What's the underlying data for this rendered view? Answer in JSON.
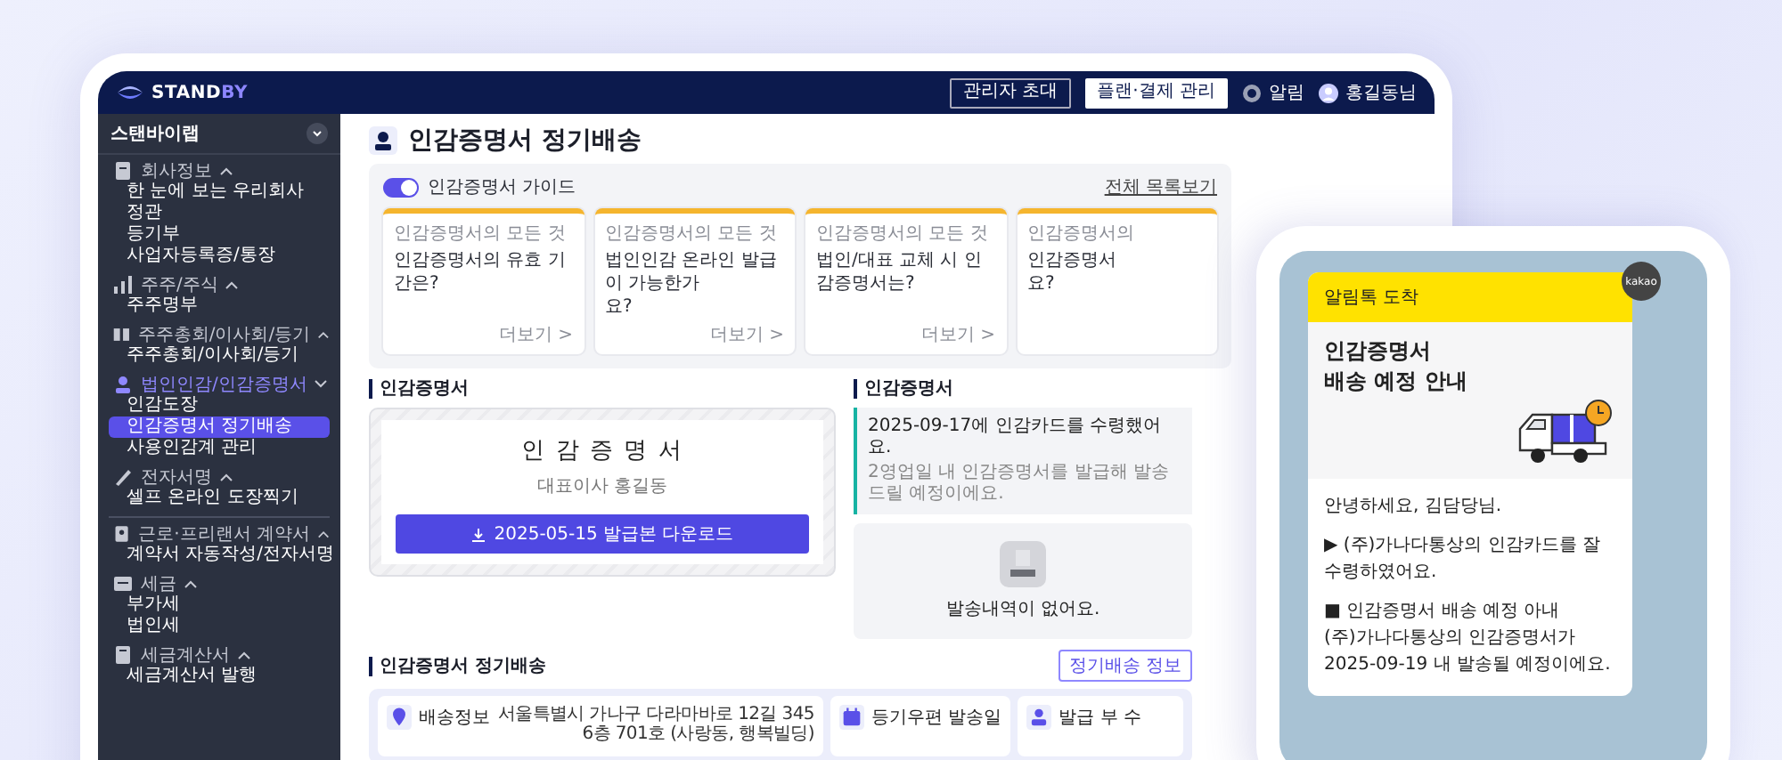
{
  "topbar": {
    "logo_parts": [
      "STAND",
      "BY"
    ],
    "buttons": [
      {
        "label": "관리자 초대",
        "kind": "outline"
      },
      {
        "label": "플랜·결제 관리",
        "kind": "filled"
      }
    ],
    "notifications": "알림",
    "user": "홍길동님"
  },
  "sidebar": {
    "company": "스탠바이랩",
    "groups": [
      {
        "title": "회사정보",
        "active": false,
        "divider_before": false,
        "items": [
          {
            "label": "한 눈에 보는 우리회사",
            "selected": false
          },
          {
            "label": "정관",
            "selected": false
          },
          {
            "label": "등기부",
            "selected": false
          },
          {
            "label": "사업자등록증/통장",
            "selected": false
          }
        ]
      },
      {
        "title": "주주/주식",
        "active": false,
        "divider_before": false,
        "items": [
          {
            "label": "주주명부",
            "selected": false
          }
        ]
      },
      {
        "title": "주주총회/이사회/등기",
        "active": false,
        "divider_before": false,
        "items": [
          {
            "label": "주주총회/이사회/등기",
            "selected": false
          }
        ]
      },
      {
        "title": "법인인감/인감증명서",
        "active": true,
        "divider_before": false,
        "items": [
          {
            "label": "인감도장",
            "selected": false
          },
          {
            "label": "인감증명서 정기배송",
            "selected": true
          },
          {
            "label": "사용인감계 관리",
            "selected": false
          }
        ]
      },
      {
        "title": "전자서명",
        "active": false,
        "divider_before": false,
        "items": [
          {
            "label": "셀프 온라인 도장찍기",
            "selected": false
          }
        ]
      },
      {
        "title": "근로·프리랜서 계약서",
        "active": false,
        "divider_before": true,
        "items": [
          {
            "label": "계약서 자동작성/전자서명",
            "selected": false
          }
        ]
      },
      {
        "title": "세금",
        "active": false,
        "divider_before": false,
        "items": [
          {
            "label": "부가세",
            "selected": false
          },
          {
            "label": "법인세",
            "selected": false
          }
        ]
      },
      {
        "title": "세금계산서",
        "active": false,
        "divider_before": false,
        "items": [
          {
            "label": "세금계산서 발행",
            "selected": false
          }
        ]
      }
    ]
  },
  "page_title": "인감증명서 정기배송",
  "guide": {
    "toggle_on": true,
    "title": "인감증명서 가이드",
    "all_link": "전체 목록보기",
    "cards": [
      {
        "label": "인감증명서의 모든 것",
        "question_lines": [
          "인감증명서의 유효 기간은?"
        ],
        "more": "더보기 >"
      },
      {
        "label": "인감증명서의 모든 것",
        "question_lines": [
          "법인인감 온라인 발급이 가능한가",
          "요?"
        ],
        "more": "더보기 >"
      },
      {
        "label": "인감증명서의 모든 것",
        "question_lines": [
          "법인/대표 교체 시 인감증명서는?"
        ],
        "more": "더보기 >"
      },
      {
        "label": "인감증명서의",
        "question_lines": [
          "인감증명서",
          "요?"
        ]
      }
    ]
  },
  "certificate": {
    "heading": "인감증명서",
    "doc_title": "인 감 증 명 서",
    "holder": "대표이사 홍길동",
    "download": "2025-05-15 발급본 다운로드"
  },
  "status": {
    "heading": "인감증명서",
    "notice_title": "2025-09-17에 인감카드를 수령했어요.",
    "notice_detail": "2영업일 내 인감증명서를 발급해 발송드릴 예정이에요.",
    "empty": "발송내역이 없어요."
  },
  "delivery": {
    "heading": "인감증명서 정기배송",
    "edit_button": "정기배송 정보",
    "cards": [
      {
        "kind": "address",
        "title": "배송정보",
        "value_lines": [
          "서울특별시 가나구 다라마바로 12길 345",
          "6층 701호 (사랑동, 행복빌딩)"
        ]
      },
      {
        "kind": "plain",
        "title": "등기우편 발송일"
      },
      {
        "kind": "plain",
        "title": "발급 부 수"
      }
    ]
  },
  "message": {
    "header": "알림톡 도착",
    "badge": "kakao",
    "title_lines": [
      "인감증명서",
      "배송 예정 안내"
    ],
    "paragraphs": [
      "안녕하세요, 김담당님.",
      "▶ (주)가나다통상의 인감카드를 잘 수령하였어요.",
      "■ 인감증명서 배송 예정 아내\n(주)가나다통상의 인감증명서가 2025-09-19 내 발송될 예정이에요."
    ]
  }
}
